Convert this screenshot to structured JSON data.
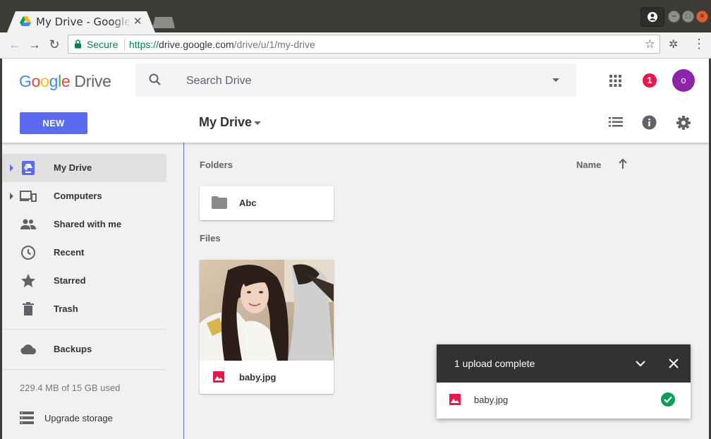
{
  "browser": {
    "tab_title": "My Drive - Google Drive",
    "secure_label": "Secure",
    "url_scheme": "https://",
    "url_host": "drive.google.com",
    "url_path": "/drive/u/1/my-drive"
  },
  "header": {
    "logo_google": "Google",
    "logo_drive": "Drive",
    "search_placeholder": "Search Drive",
    "notification_count": "1",
    "avatar_initial": "o",
    "new_button": "NEW",
    "location_title": "My Drive"
  },
  "sidebar": {
    "items": [
      {
        "label": "My Drive"
      },
      {
        "label": "Computers"
      },
      {
        "label": "Shared with me"
      },
      {
        "label": "Recent"
      },
      {
        "label": "Starred"
      },
      {
        "label": "Trash"
      },
      {
        "label": "Backups"
      }
    ],
    "storage_text": "229.4 MB of 15 GB used",
    "upgrade_label": "Upgrade storage"
  },
  "main": {
    "folders_label": "Folders",
    "files_label": "Files",
    "sort_label": "Name",
    "folders": [
      {
        "name": "Abc"
      }
    ],
    "files": [
      {
        "name": "baby.jpg"
      }
    ]
  },
  "upload": {
    "title": "1 upload complete",
    "file_name": "baby.jpg"
  },
  "colors": {
    "accent": "#5b6af0",
    "notification": "#e8184c",
    "avatar": "#8e24aa",
    "success": "#0f9d58",
    "image_file": "#e8184c"
  }
}
